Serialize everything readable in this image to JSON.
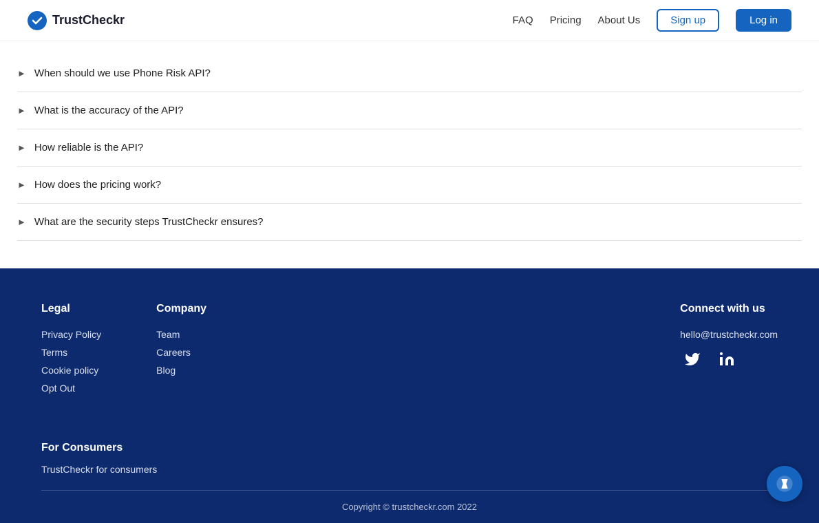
{
  "navbar": {
    "logo_text": "TrustCheckr",
    "links": [
      {
        "label": "FAQ",
        "id": "faq"
      },
      {
        "label": "Pricing",
        "id": "pricing"
      },
      {
        "label": "About Us",
        "id": "about"
      }
    ],
    "signup_label": "Sign up",
    "login_label": "Log in"
  },
  "faq": {
    "items": [
      {
        "text": "When should we use Phone Risk API?"
      },
      {
        "text": "What is the accuracy of the API?"
      },
      {
        "text": "How reliable is the API?"
      },
      {
        "text": "How does the pricing work?"
      },
      {
        "text": "What are the security steps TrustCheckr ensures?"
      }
    ]
  },
  "footer": {
    "legal": {
      "heading": "Legal",
      "links": [
        {
          "label": "Privacy Policy"
        },
        {
          "label": "Terms"
        },
        {
          "label": "Cookie policy"
        },
        {
          "label": "Opt Out"
        }
      ]
    },
    "company": {
      "heading": "Company",
      "links": [
        {
          "label": "Team"
        },
        {
          "label": "Careers"
        },
        {
          "label": "Blog"
        }
      ]
    },
    "connect": {
      "heading": "Connect with us",
      "email": "hello@trustcheckr.com"
    },
    "consumers": {
      "heading": "For Consumers",
      "link": "TrustCheckr for consumers"
    },
    "copyright": "Copyright © trustcheckr.com 2022"
  }
}
